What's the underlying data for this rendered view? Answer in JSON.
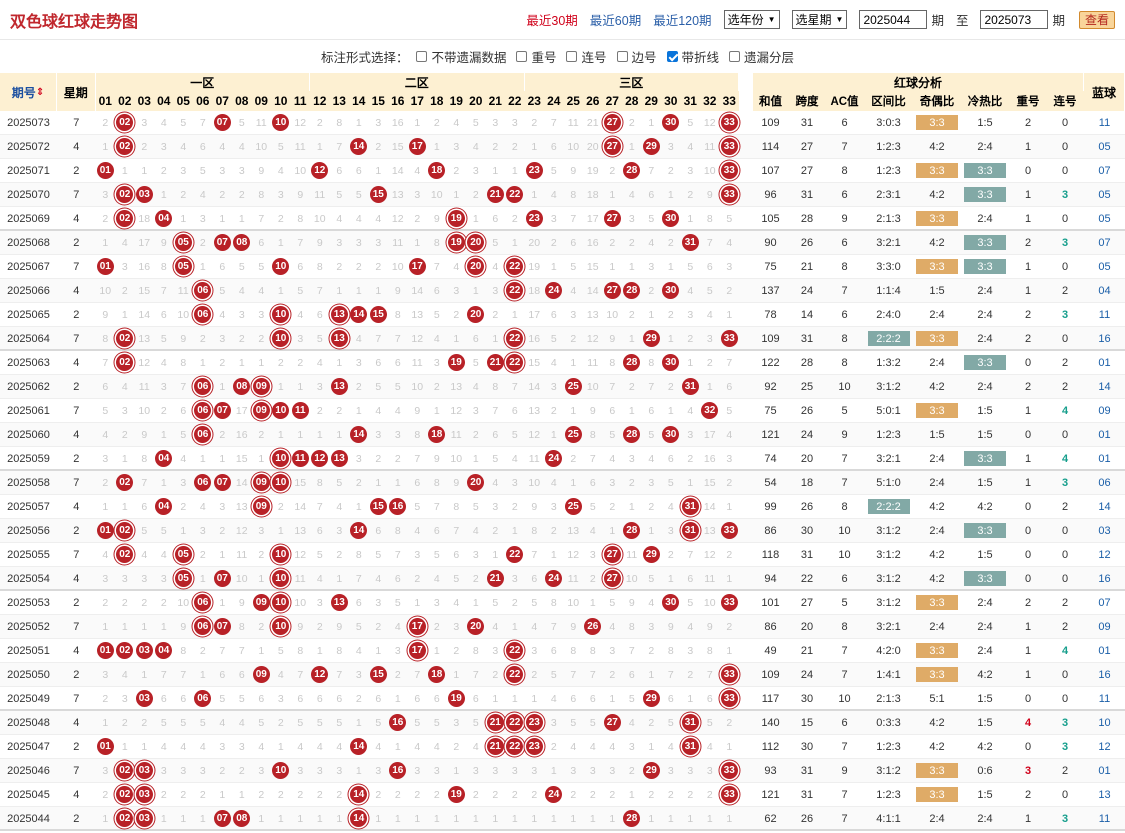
{
  "title": "双色球红球走势图",
  "nav": {
    "recent": [
      "最近30期",
      "最近60期",
      "最近120期"
    ],
    "active": 0,
    "year_select": "选年份",
    "week_select": "选星期",
    "from_issue": "2025044",
    "qi1": "期",
    "to": "至",
    "to_issue": "2025073",
    "qi2": "期",
    "search": "查看"
  },
  "options": {
    "label": "标注形式选择：",
    "items": [
      {
        "label": "不带遗漏数据",
        "checked": false
      },
      {
        "label": "重号",
        "checked": false
      },
      {
        "label": "连号",
        "checked": false
      },
      {
        "label": "边号",
        "checked": false
      },
      {
        "label": "带折线",
        "checked": true
      },
      {
        "label": "遗漏分层",
        "checked": false
      }
    ]
  },
  "header": {
    "issue": "期号",
    "week": "星期",
    "zones": [
      "一区",
      "二区",
      "三区"
    ],
    "analysis": "红球分析",
    "cols": [
      "和值",
      "跨度",
      "AC值",
      "区间比",
      "奇偶比",
      "冷热比",
      "重号",
      "连号"
    ],
    "blue": "蓝球"
  },
  "rows": [
    {
      "issue": "2025073",
      "week": "7",
      "red": [
        2,
        7,
        10,
        27,
        30,
        33
      ],
      "sum": "109",
      "span": "31",
      "ac": "6",
      "zone": "3:0:3",
      "oe": "3:3",
      "ch": "1:5",
      "rep": "2",
      "con": "0",
      "blue": "11"
    },
    {
      "issue": "2025072",
      "week": "4",
      "red": [
        2,
        14,
        17,
        27,
        29,
        33
      ],
      "sum": "114",
      "span": "27",
      "ac": "7",
      "zone": "1:2:3",
      "oe": "4:2",
      "ch": "2:4",
      "rep": "1",
      "con": "0",
      "blue": "05"
    },
    {
      "issue": "2025071",
      "week": "2",
      "red": [
        1,
        12,
        18,
        23,
        28,
        33
      ],
      "sum": "107",
      "span": "27",
      "ac": "8",
      "zone": "1:2:3",
      "oe": "3:3",
      "ch": "3:3",
      "rep": "0",
      "con": "0",
      "blue": "07"
    },
    {
      "issue": "2025070",
      "week": "7",
      "red": [
        2,
        3,
        15,
        21,
        22,
        33
      ],
      "sum": "96",
      "span": "31",
      "ac": "6",
      "zone": "2:3:1",
      "oe": "4:2",
      "ch": "3:3",
      "rep": "1",
      "con": "3",
      "blue": "05"
    },
    {
      "issue": "2025069",
      "week": "4",
      "red": [
        2,
        4,
        19,
        23,
        27,
        30
      ],
      "sum": "105",
      "span": "28",
      "ac": "9",
      "zone": "2:1:3",
      "oe": "3:3",
      "ch": "2:4",
      "rep": "1",
      "con": "0",
      "blue": "05"
    },
    {
      "issue": "2025068",
      "week": "2",
      "red": [
        5,
        7,
        8,
        19,
        20,
        31
      ],
      "sum": "90",
      "span": "26",
      "ac": "6",
      "zone": "3:2:1",
      "oe": "4:2",
      "ch": "3:3",
      "rep": "2",
      "con": "3",
      "blue": "07"
    },
    {
      "issue": "2025067",
      "week": "7",
      "red": [
        1,
        5,
        10,
        17,
        20,
        22
      ],
      "sum": "75",
      "span": "21",
      "ac": "8",
      "zone": "3:3:0",
      "oe": "3:3",
      "ch": "3:3",
      "rep": "1",
      "con": "0",
      "blue": "05"
    },
    {
      "issue": "2025066",
      "week": "4",
      "red": [
        6,
        22,
        24,
        27,
        28,
        30
      ],
      "sum": "137",
      "span": "24",
      "ac": "7",
      "zone": "1:1:4",
      "oe": "1:5",
      "ch": "2:4",
      "rep": "1",
      "con": "2",
      "blue": "04"
    },
    {
      "issue": "2025065",
      "week": "2",
      "red": [
        6,
        10,
        13,
        14,
        15,
        20
      ],
      "sum": "78",
      "span": "14",
      "ac": "6",
      "zone": "2:4:0",
      "oe": "2:4",
      "ch": "2:4",
      "rep": "2",
      "con": "3",
      "blue": "11"
    },
    {
      "issue": "2025064",
      "week": "7",
      "red": [
        2,
        10,
        13,
        22,
        29,
        33
      ],
      "sum": "109",
      "span": "31",
      "ac": "8",
      "zone": "2:2:2",
      "oe": "3:3",
      "ch": "2:4",
      "rep": "2",
      "con": "0",
      "blue": "16"
    },
    {
      "issue": "2025063",
      "week": "4",
      "red": [
        2,
        19,
        21,
        22,
        28,
        30
      ],
      "sum": "122",
      "span": "28",
      "ac": "8",
      "zone": "1:3:2",
      "oe": "2:4",
      "ch": "3:3",
      "rep": "0",
      "con": "2",
      "blue": "01"
    },
    {
      "issue": "2025062",
      "week": "2",
      "red": [
        6,
        8,
        9,
        13,
        25,
        31
      ],
      "sum": "92",
      "span": "25",
      "ac": "10",
      "zone": "3:1:2",
      "oe": "4:2",
      "ch": "2:4",
      "rep": "2",
      "con": "2",
      "blue": "14"
    },
    {
      "issue": "2025061",
      "week": "7",
      "red": [
        6,
        7,
        9,
        10,
        11,
        32
      ],
      "sum": "75",
      "span": "26",
      "ac": "5",
      "zone": "5:0:1",
      "oe": "3:3",
      "ch": "1:5",
      "rep": "1",
      "con": "4",
      "blue": "09"
    },
    {
      "issue": "2025060",
      "week": "4",
      "red": [
        6,
        14,
        18,
        25,
        28,
        30
      ],
      "sum": "121",
      "span": "24",
      "ac": "9",
      "zone": "1:2:3",
      "oe": "1:5",
      "ch": "1:5",
      "rep": "0",
      "con": "0",
      "blue": "01"
    },
    {
      "issue": "2025059",
      "week": "2",
      "red": [
        4,
        10,
        11,
        12,
        13,
        24
      ],
      "sum": "74",
      "span": "20",
      "ac": "7",
      "zone": "3:2:1",
      "oe": "2:4",
      "ch": "3:3",
      "rep": "1",
      "con": "4",
      "blue": "01"
    },
    {
      "issue": "2025058",
      "week": "7",
      "red": [
        2,
        6,
        7,
        9,
        10,
        20
      ],
      "sum": "54",
      "span": "18",
      "ac": "7",
      "zone": "5:1:0",
      "oe": "2:4",
      "ch": "1:5",
      "rep": "1",
      "con": "3",
      "blue": "06"
    },
    {
      "issue": "2025057",
      "week": "4",
      "red": [
        4,
        9,
        15,
        16,
        25,
        31
      ],
      "sum": "99",
      "span": "26",
      "ac": "8",
      "zone": "2:2:2",
      "oe": "4:2",
      "ch": "4:2",
      "rep": "0",
      "con": "2",
      "blue": "14"
    },
    {
      "issue": "2025056",
      "week": "2",
      "red": [
        1,
        2,
        14,
        28,
        31,
        33
      ],
      "sum": "86",
      "span": "30",
      "ac": "10",
      "zone": "3:1:2",
      "oe": "2:4",
      "ch": "3:3",
      "rep": "0",
      "con": "0",
      "blue": "03"
    },
    {
      "issue": "2025055",
      "week": "7",
      "red": [
        2,
        5,
        10,
        22,
        27,
        29
      ],
      "sum": "118",
      "span": "31",
      "ac": "10",
      "zone": "3:1:2",
      "oe": "4:2",
      "ch": "1:5",
      "rep": "0",
      "con": "0",
      "blue": "12"
    },
    {
      "issue": "2025054",
      "week": "4",
      "red": [
        5,
        7,
        10,
        21,
        24,
        27
      ],
      "sum": "94",
      "span": "22",
      "ac": "6",
      "zone": "3:1:2",
      "oe": "4:2",
      "ch": "3:3",
      "rep": "0",
      "con": "0",
      "blue": "16"
    },
    {
      "issue": "2025053",
      "week": "2",
      "red": [
        6,
        9,
        10,
        13,
        30,
        33
      ],
      "sum": "101",
      "span": "27",
      "ac": "5",
      "zone": "3:1:2",
      "oe": "3:3",
      "ch": "2:4",
      "rep": "2",
      "con": "2",
      "blue": "07"
    },
    {
      "issue": "2025052",
      "week": "7",
      "red": [
        6,
        7,
        10,
        17,
        20,
        26
      ],
      "sum": "86",
      "span": "20",
      "ac": "8",
      "zone": "3:2:1",
      "oe": "2:4",
      "ch": "2:4",
      "rep": "1",
      "con": "2",
      "blue": "09"
    },
    {
      "issue": "2025051",
      "week": "4",
      "red": [
        1,
        2,
        3,
        4,
        17,
        22
      ],
      "sum": "49",
      "span": "21",
      "ac": "7",
      "zone": "4:2:0",
      "oe": "3:3",
      "ch": "2:4",
      "rep": "1",
      "con": "4",
      "blue": "01"
    },
    {
      "issue": "2025050",
      "week": "2",
      "red": [
        9,
        12,
        15,
        18,
        22,
        33
      ],
      "sum": "109",
      "span": "24",
      "ac": "7",
      "zone": "1:4:1",
      "oe": "3:3",
      "ch": "4:2",
      "rep": "1",
      "con": "0",
      "blue": "16"
    },
    {
      "issue": "2025049",
      "week": "7",
      "red": [
        3,
        6,
        19,
        29,
        33
      ],
      "sum": "117",
      "span": "30",
      "ac": "10",
      "zone": "2:1:3",
      "oe": "5:1",
      "ch": "1:5",
      "rep": "0",
      "con": "0",
      "blue": "11"
    },
    {
      "issue": "2025048",
      "week": "4",
      "red": [
        16,
        21,
        22,
        23,
        27,
        31
      ],
      "sum": "140",
      "span": "15",
      "ac": "6",
      "zone": "0:3:3",
      "oe": "4:2",
      "ch": "1:5",
      "rep": "4",
      "con": "3",
      "blue": "10"
    },
    {
      "issue": "2025047",
      "week": "2",
      "red": [
        1,
        14,
        21,
        22,
        23,
        31
      ],
      "sum": "112",
      "span": "30",
      "ac": "7",
      "zone": "1:2:3",
      "oe": "4:2",
      "ch": "4:2",
      "rep": "0",
      "con": "3",
      "blue": "12"
    },
    {
      "issue": "2025046",
      "week": "7",
      "red": [
        2,
        3,
        10,
        16,
        29,
        33
      ],
      "sum": "93",
      "span": "31",
      "ac": "9",
      "zone": "3:1:2",
      "oe": "3:3",
      "ch": "0:6",
      "rep": "3",
      "con": "2",
      "blue": "01"
    },
    {
      "issue": "2025045",
      "week": "4",
      "red": [
        2,
        3,
        14,
        19,
        24,
        33
      ],
      "sum": "121",
      "span": "31",
      "ac": "7",
      "zone": "1:2:3",
      "oe": "3:3",
      "ch": "1:5",
      "rep": "2",
      "con": "0",
      "blue": "13"
    },
    {
      "issue": "2025044",
      "week": "2",
      "red": [
        2,
        3,
        7,
        8,
        14,
        28
      ],
      "sum": "62",
      "span": "26",
      "ac": "7",
      "zone": "4:1:1",
      "oe": "2:4",
      "ch": "2:4",
      "rep": "1",
      "con": "3",
      "blue": "11"
    }
  ]
}
